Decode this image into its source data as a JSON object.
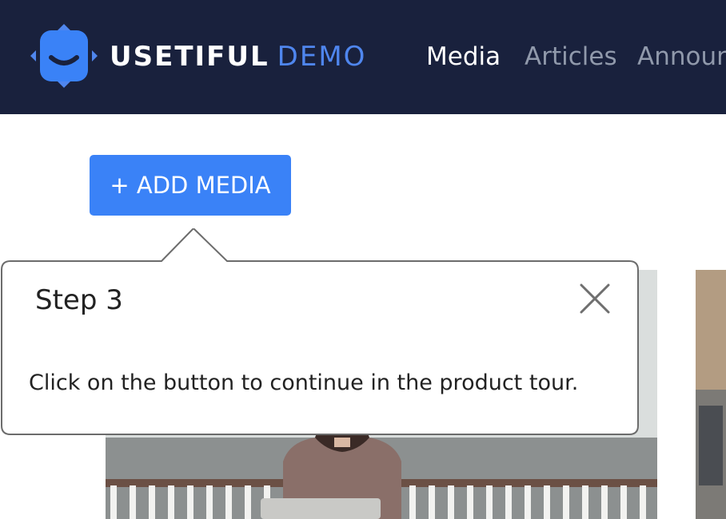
{
  "header": {
    "brand_name": "USETIFUL",
    "brand_suffix": "DEMO",
    "logo_icon": "usetiful-smiley-logo-icon",
    "nav": [
      {
        "label": "Media",
        "active": true
      },
      {
        "label": "Articles",
        "active": false
      },
      {
        "label": "Announ",
        "active": false
      }
    ]
  },
  "main": {
    "add_media_label": "+ ADD MEDIA"
  },
  "tour": {
    "title": "Step 3",
    "body": "Click on the button to continue in the product tour.",
    "close_icon": "close-icon"
  },
  "colors": {
    "header_bg": "#19213d",
    "accent": "#3a82f7",
    "brand_suffix": "#4f86ee"
  }
}
